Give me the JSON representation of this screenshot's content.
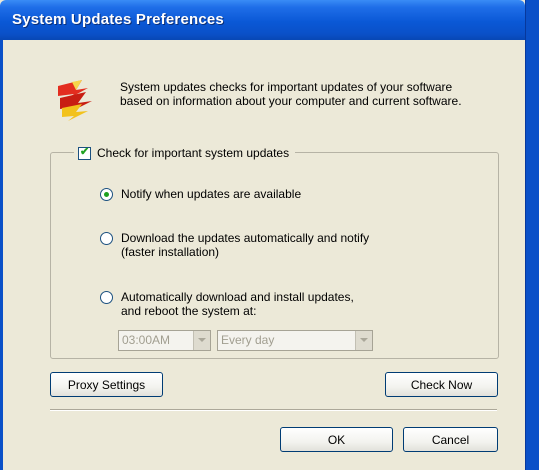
{
  "window": {
    "title": "System Updates Preferences"
  },
  "description": "System updates checks for important updates of your software based on information about your computer and current software.",
  "check_updates": {
    "label": "Check for important system updates",
    "checked": true
  },
  "options": [
    {
      "label": "Notify when updates are available",
      "selected": true
    },
    {
      "label": "Download the updates automatically and notify",
      "label2": "(faster installation)",
      "selected": false
    },
    {
      "label": "Automatically download and install updates,",
      "label2": "and reboot the system at:",
      "selected": false
    }
  ],
  "schedule": {
    "time": "03:00AM",
    "day": "Every day"
  },
  "buttons": {
    "proxy": "Proxy Settings",
    "check_now": "Check Now",
    "ok": "OK",
    "cancel": "Cancel"
  }
}
